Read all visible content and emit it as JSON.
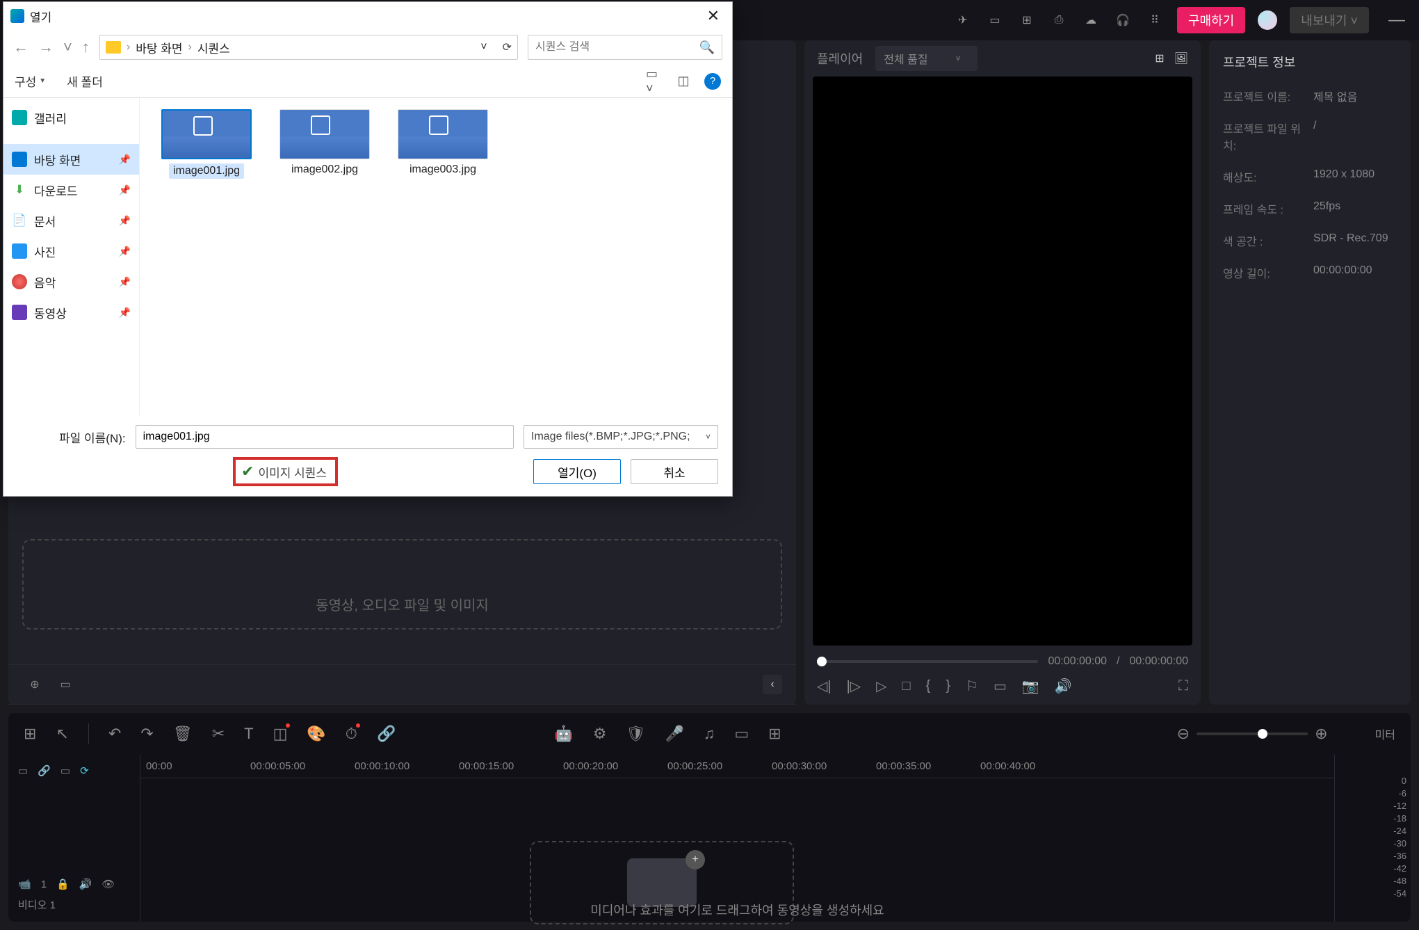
{
  "titlebar": {
    "buy_label": "구매하기",
    "export_label": "내보내기"
  },
  "player": {
    "label": "플레이어",
    "quality_label": "전체 품질",
    "time_current": "00:00:00:00",
    "time_total": "00:00:00:00"
  },
  "info": {
    "title": "프로젝트 정보",
    "rows": [
      {
        "label": "프로젝트 이름:",
        "value": "제목 없음"
      },
      {
        "label": "프로젝트 파일 위치:",
        "value": "/"
      },
      {
        "label": "해상도:",
        "value": "1920 x 1080"
      },
      {
        "label": "프레임 속도 :",
        "value": "25fps"
      },
      {
        "label": "색 공간 :",
        "value": "SDR - Rec.709"
      },
      {
        "label": "영상 길이:",
        "value": "00:00:00:00"
      }
    ]
  },
  "dropzone_text": "동영상, 오디오 파일 및 이미지",
  "timeline": {
    "meter_title": "미터",
    "track_label": "비디오 1",
    "hint": "미디어나 효과를 여기로 드래그하여 동영상을 생성하세요",
    "ruler": [
      "00:00",
      "00:00:05:00",
      "00:00:10:00",
      "00:00:15:00",
      "00:00:20:00",
      "00:00:25:00",
      "00:00:30:00",
      "00:00:35:00",
      "00:00:40:00"
    ],
    "scale": [
      "0",
      "-6",
      "-12",
      "-18",
      "-24",
      "-30",
      "-36",
      "-42",
      "-48",
      "-54"
    ]
  },
  "dialog": {
    "title": "열기",
    "breadcrumb": [
      "바탕 화면",
      "시퀀스"
    ],
    "search_placeholder": "시퀀스 검색",
    "organize": "구성",
    "new_folder": "새 폴더",
    "sidebar": [
      {
        "label": "갤러리",
        "icon": "gallery"
      },
      {
        "label": "바탕 화면",
        "icon": "desktop",
        "selected": true,
        "pin": true
      },
      {
        "label": "다운로드",
        "icon": "download",
        "pin": true
      },
      {
        "label": "문서",
        "icon": "doc",
        "pin": true
      },
      {
        "label": "사진",
        "icon": "photo",
        "pin": true
      },
      {
        "label": "음악",
        "icon": "music",
        "pin": true
      },
      {
        "label": "동영상",
        "icon": "video",
        "pin": true
      }
    ],
    "files": [
      {
        "name": "image001.jpg",
        "selected": true
      },
      {
        "name": "image002.jpg"
      },
      {
        "name": "image003.jpg"
      }
    ],
    "filename_label": "파일 이름(N):",
    "filename_value": "image001.jpg",
    "filter_label": "Image files(*.BMP;*.JPG;*.PNG;",
    "sequence_checkbox": "이미지 시퀀스",
    "open_btn": "열기(O)",
    "cancel_btn": "취소"
  }
}
